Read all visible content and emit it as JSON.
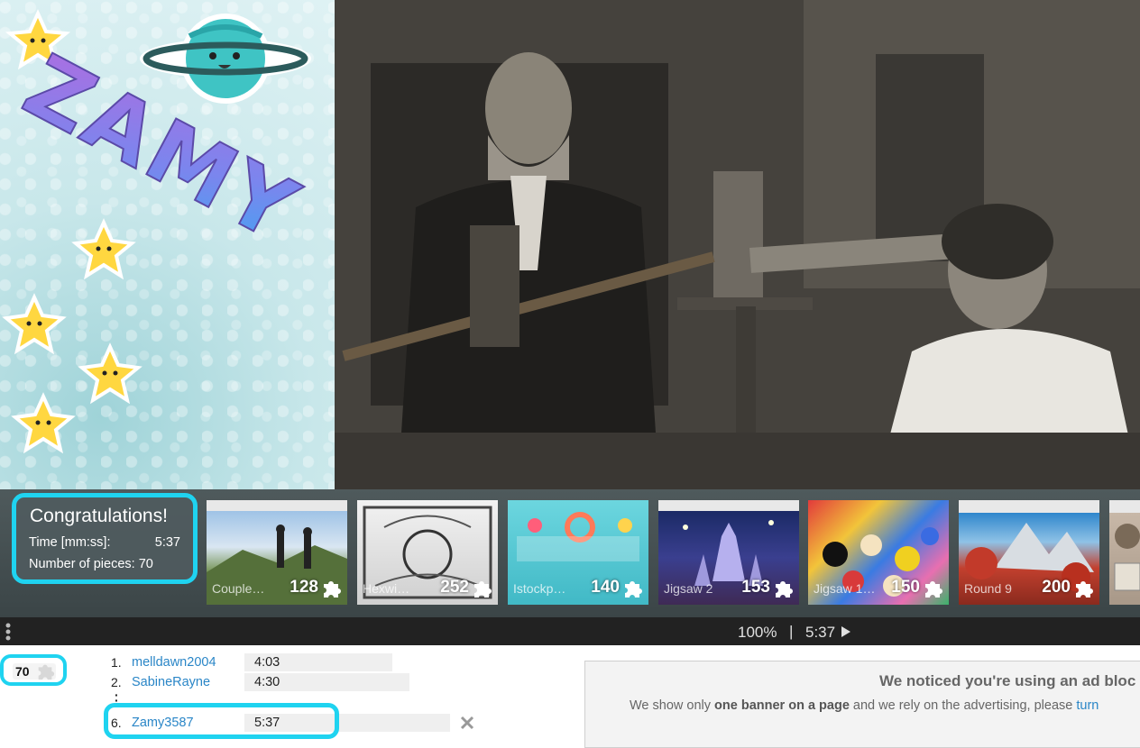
{
  "logo": {
    "text": "ZAMY"
  },
  "congrats": {
    "title": "Congratulations!",
    "time_label": "Time [mm:ss]:",
    "time_value": "5:37",
    "pieces_label": "Number of pieces:",
    "pieces_value": "70"
  },
  "gallery": [
    {
      "label": "Couple…",
      "count": "128",
      "icon": "puzzle-piece-icon"
    },
    {
      "label": "Hexwi…",
      "count": "252",
      "icon": "puzzle-piece-icon"
    },
    {
      "label": "Istockp…",
      "count": "140",
      "icon": "puzzle-piece-icon"
    },
    {
      "label": "Jigsaw 2",
      "count": "153",
      "icon": "puzzle-piece-icon"
    },
    {
      "label": "Jigsaw 1…",
      "count": "150",
      "icon": "puzzle-piece-icon"
    },
    {
      "label": "Round 9",
      "count": "200",
      "icon": "puzzle-piece-icon"
    }
  ],
  "controls": {
    "zoom": "100%",
    "separator": "|",
    "time": "5:37"
  },
  "pieces_badge": {
    "count": "70"
  },
  "leaderboard": [
    {
      "rank": "1.",
      "name": "melldawn2004",
      "time": "4:03"
    },
    {
      "rank": "2.",
      "name": "SabineRayne",
      "time": "4:30"
    },
    {
      "rank": "6.",
      "name": "Zamy3587",
      "time": "5:37"
    }
  ],
  "ad": {
    "title": "We noticed you're using an ad bloc",
    "text_1": "We show only ",
    "text_bold": "one banner on a page",
    "text_2": " and we rely on the advertising, please ",
    "link": "turn"
  },
  "colors": {
    "highlight": "#1fd3f0",
    "link": "#2a86c7",
    "control_bar": "#222222"
  }
}
